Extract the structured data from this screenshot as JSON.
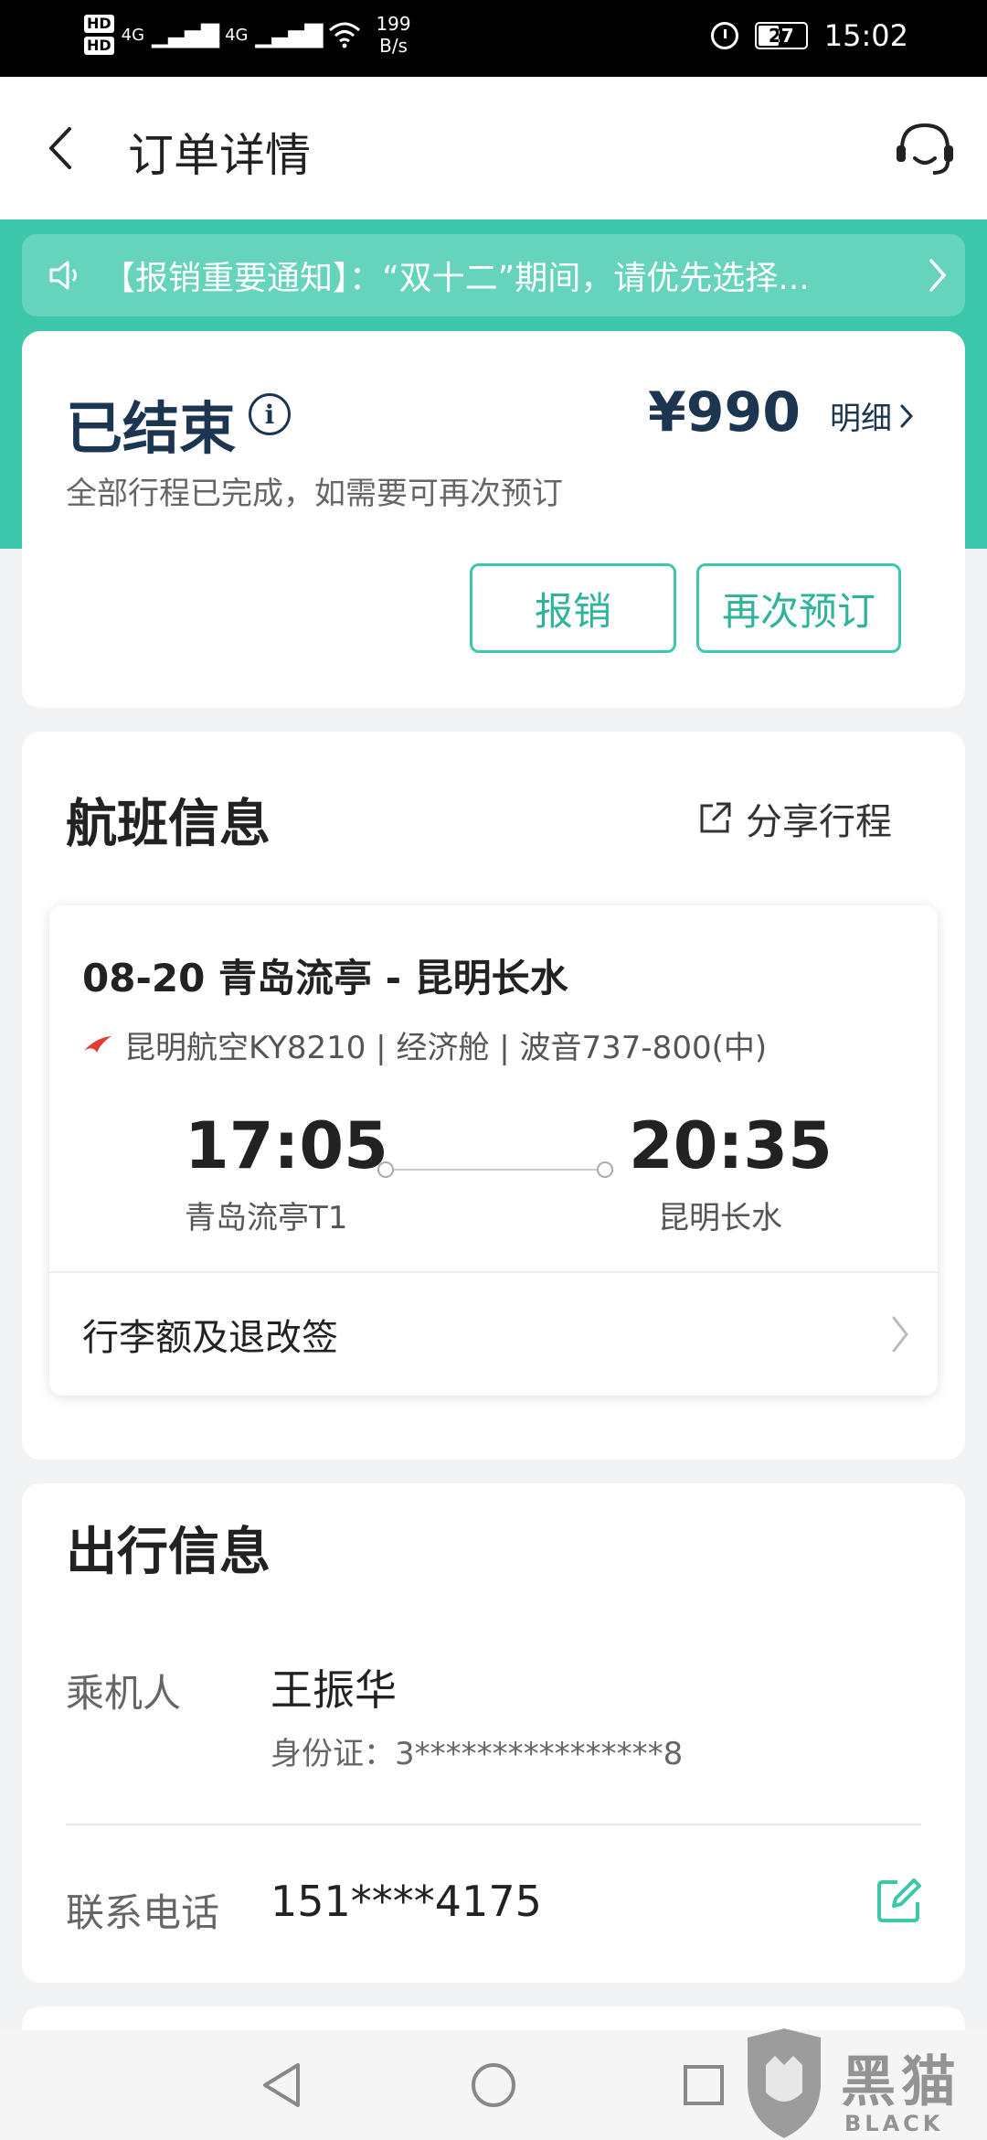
{
  "status_bar": {
    "network_hd_top": "HD",
    "network_hd_bottom": "HD",
    "net_type_1": "4G",
    "net_type_2": "4G",
    "speed_value": "199",
    "speed_unit": "B/s",
    "battery": "27",
    "time": "15:02"
  },
  "header": {
    "title": "订单详情"
  },
  "notice": {
    "text": "【报销重要通知】：“双十二”期间，请优先选择..."
  },
  "order_status": {
    "title": "已结束",
    "price": "¥990",
    "detail_label": "明细",
    "subtitle": "全部行程已完成，如需要可再次预订",
    "reimburse_label": "报销",
    "rebook_label": "再次预订"
  },
  "flight": {
    "section_title": "航班信息",
    "share_label": "分享行程",
    "route": "08-20 青岛流亭 - 昆明长水",
    "airline_info": "昆明航空KY8210 | 经济舱 | 波音737-800(中)",
    "dep_time": "17:05",
    "arr_time": "20:35",
    "dep_airport": "青岛流亭T1",
    "arr_airport": "昆明长水",
    "baggage_label": "行李额及退改签"
  },
  "travel": {
    "section_title": "出行信息",
    "passenger_label": "乘机人",
    "passenger_name": "王振华",
    "id_text": "身份证：3****************8",
    "phone_label": "联系电话",
    "phone_value": "151****4175"
  },
  "watermark": {
    "name": "黑猫",
    "en": "BLACK CAT"
  },
  "colors": {
    "accent": "#3cc7ab",
    "title_dark": "#1c3651",
    "airline_logo": "#e23b3b"
  }
}
